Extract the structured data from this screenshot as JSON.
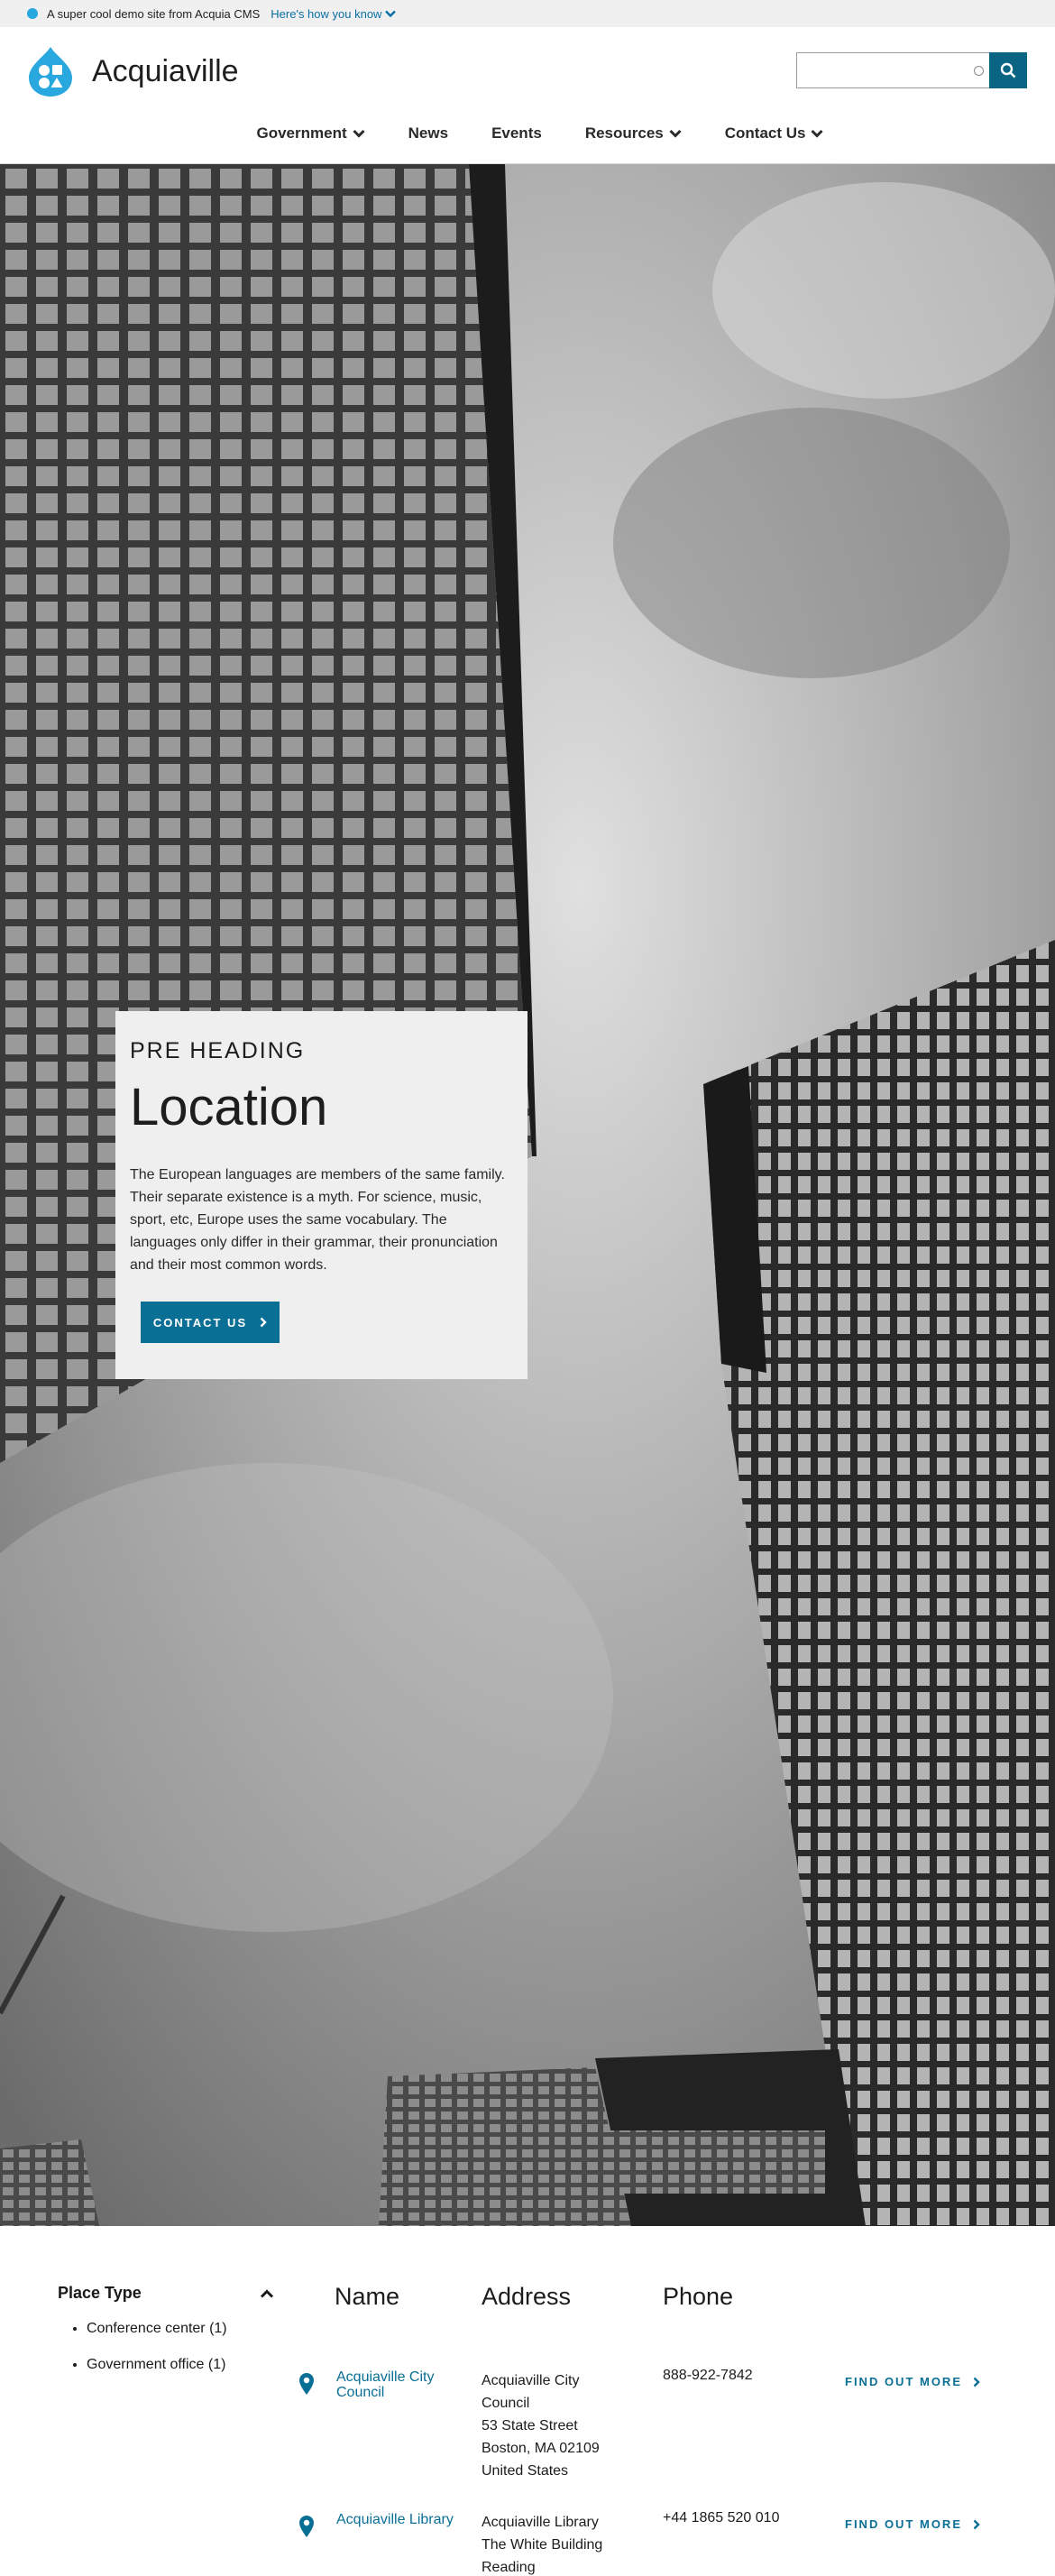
{
  "topbar": {
    "message": "A super cool demo site from Acquia CMS",
    "link_label": "Here's how you know"
  },
  "header": {
    "site_name": "Acquiaville",
    "search": {
      "placeholder": ""
    }
  },
  "nav": {
    "items": [
      {
        "label": "Government",
        "has_dropdown": true
      },
      {
        "label": "News",
        "has_dropdown": false
      },
      {
        "label": "Events",
        "has_dropdown": false
      },
      {
        "label": "Resources",
        "has_dropdown": true
      },
      {
        "label": "Contact Us",
        "has_dropdown": true
      }
    ]
  },
  "hero": {
    "pre_heading": "PRE HEADING",
    "title": "Location",
    "body": "The European languages are members of the same family. Their separate existence is a myth. For science, music, sport, etc, Europe uses the same vocabulary. The languages only differ in their grammar, their pronunciation and their most common words.",
    "button_label": "CONTACT US"
  },
  "filters": {
    "title": "Place Type",
    "options": [
      "Conference center (1)",
      "Government office (1)"
    ]
  },
  "table": {
    "columns": [
      "Name",
      "Address",
      "Phone"
    ],
    "rows": [
      {
        "name": "Acquiaville City Council",
        "address": [
          "Acquiaville City",
          "Council",
          "53 State Street",
          "Boston, MA 02109",
          "United States"
        ],
        "phone": "888-922-7842",
        "more": "FIND OUT MORE"
      },
      {
        "name": "Acquiaville Library",
        "address": [
          "Acquiaville Library",
          "The White Building",
          "Reading"
        ],
        "phone": "+44 1865 520 010",
        "more": "FIND OUT MORE"
      }
    ]
  },
  "colors": {
    "accent": "#0a6f95",
    "brand_blue": "#29a8e0",
    "topbar_bg": "#f0f0f0",
    "card_bg": "#efefef"
  }
}
